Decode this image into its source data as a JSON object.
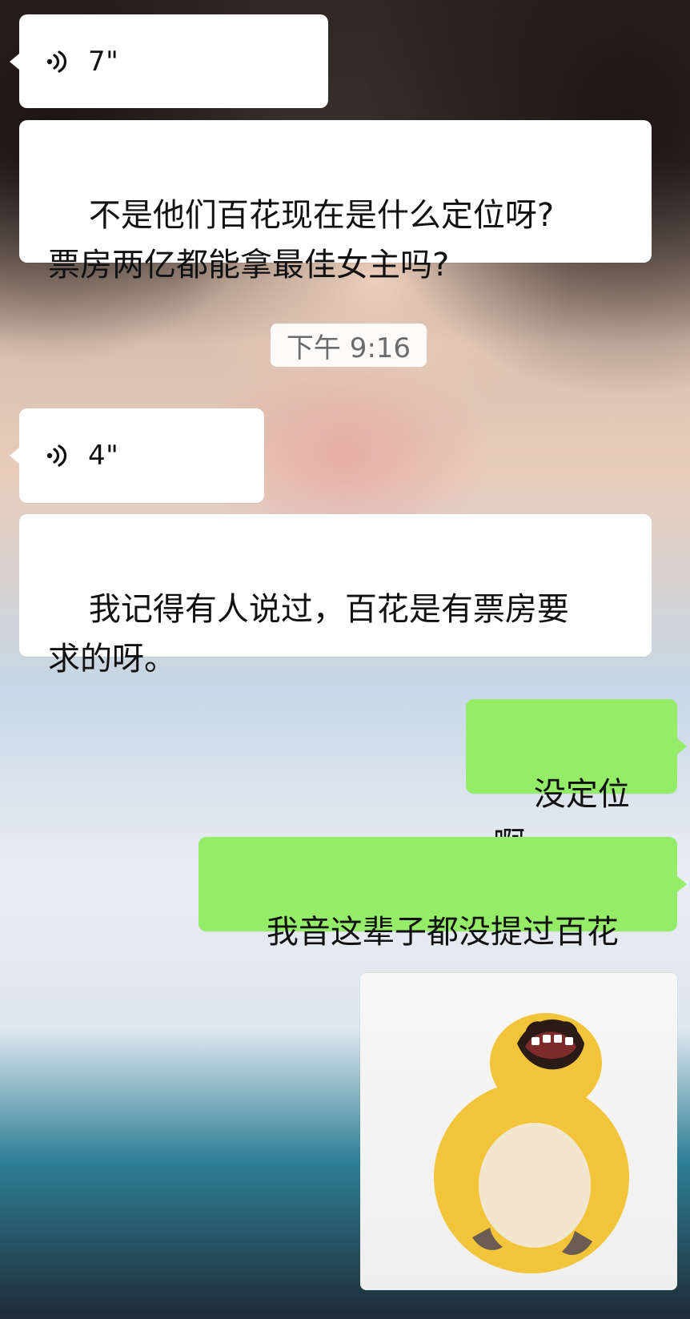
{
  "chat": {
    "messages": [
      {
        "type": "voice",
        "direction": "incoming",
        "duration": "7\"",
        "icon": "voice-wave-icon"
      },
      {
        "type": "text",
        "direction": "incoming",
        "text": "不是他们百花现在是什么定位呀?\n票房两亿都能拿最佳女主吗?"
      },
      {
        "type": "timestamp",
        "text": "下午 9:16"
      },
      {
        "type": "voice",
        "direction": "incoming",
        "duration": "4\"",
        "icon": "voice-wave-icon"
      },
      {
        "type": "text",
        "direction": "incoming",
        "text": "我记得有人说过，百花是有票房要\n求的呀。"
      },
      {
        "type": "text",
        "direction": "outgoing",
        "text": "没定位啊"
      },
      {
        "type": "text",
        "direction": "outgoing",
        "text": "我音这辈子都没提过百花"
      },
      {
        "type": "sticker",
        "direction": "outgoing",
        "icon": "laughing-yellow-monster-sticker"
      }
    ]
  },
  "colors": {
    "incoming_bubble": "#ffffff",
    "outgoing_bubble": "#95ec69",
    "timestamp_bg": "#ffffff",
    "timestamp_text": "#6b6b6b"
  }
}
